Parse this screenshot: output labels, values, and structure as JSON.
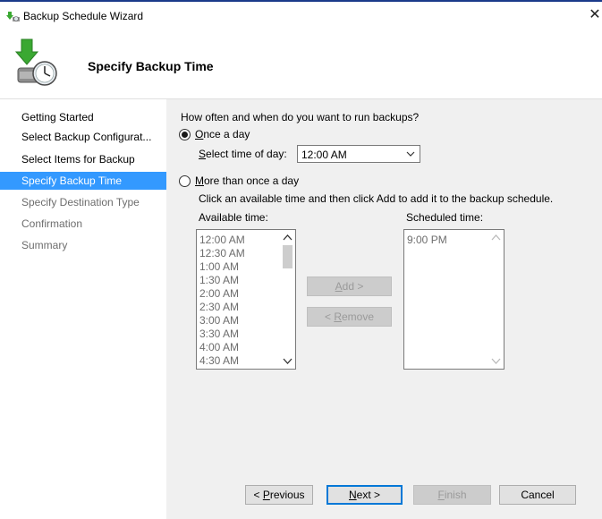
{
  "window": {
    "title": "Backup Schedule Wizard"
  },
  "header": {
    "title": "Specify Backup Time"
  },
  "nav": {
    "items": [
      {
        "label": "Getting Started"
      },
      {
        "label": "Select Backup Configurat..."
      },
      {
        "label": "Select Items for Backup"
      },
      {
        "label": "Specify Backup Time"
      },
      {
        "label": "Specify Destination Type"
      },
      {
        "label": "Confirmation"
      },
      {
        "label": "Summary"
      }
    ],
    "selected_index": 3
  },
  "content": {
    "question": "How often and when do you want to run backups?",
    "once_a_day": {
      "accel": "O",
      "rest": "nce a day",
      "selected": true
    },
    "select_time": {
      "accel": "S",
      "rest": "elect time of day:",
      "value": "12:00 AM"
    },
    "more_than_once": {
      "accel": "M",
      "rest": "ore than once a day",
      "selected": false
    },
    "instruction": "Click an available time and then click Add to add it to the backup schedule.",
    "available_label": "Available time:",
    "scheduled_label": "Scheduled time:",
    "available_times": [
      "12:00 AM",
      "12:30 AM",
      "1:00 AM",
      "1:30 AM",
      "2:00 AM",
      "2:30 AM",
      "3:00 AM",
      "3:30 AM",
      "4:00 AM",
      "4:30 AM"
    ],
    "scheduled_times": [
      "9:00 PM"
    ],
    "add_button": {
      "accel": "A",
      "rest": "dd >"
    },
    "remove_button": {
      "pre": "< ",
      "accel": "R",
      "rest": "emove"
    }
  },
  "footer": {
    "previous": {
      "pre": "< ",
      "accel": "P",
      "rest": "revious"
    },
    "next": {
      "accel": "N",
      "rest": "ext >"
    },
    "finish": {
      "accel": "F",
      "rest": "inish"
    },
    "cancel": "Cancel"
  }
}
